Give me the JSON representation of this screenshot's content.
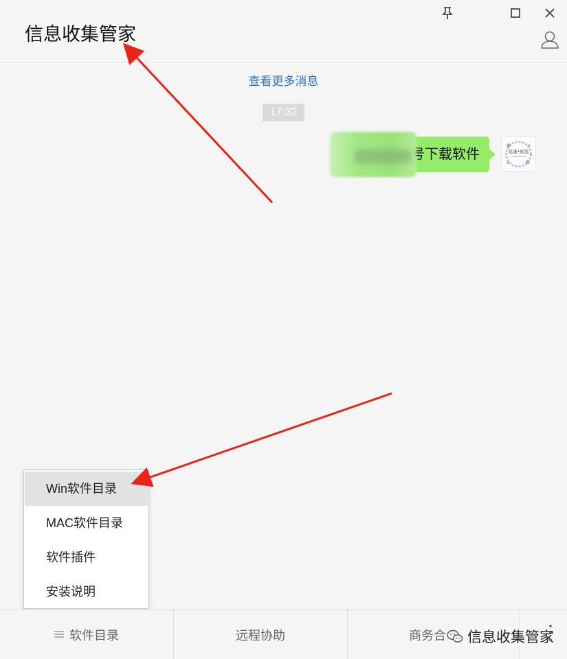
{
  "window": {
    "chat_title": "信息收集管家",
    "controls": [
      "pin-icon",
      "maximize-icon",
      "close-icon"
    ],
    "profile_icon": "person-icon"
  },
  "messages": {
    "load_more": "查看更多消息",
    "timestamp": "17:32",
    "sent_message": {
      "visible_text": "号下载软件",
      "bubble_color": "#95ec69",
      "avatar_text": "花漾•知见"
    }
  },
  "popup_menu": {
    "items": [
      {
        "label": "Win软件目录",
        "highlighted": true
      },
      {
        "label": "MAC软件目录",
        "highlighted": false
      },
      {
        "label": "软件插件",
        "highlighted": false
      },
      {
        "label": "安装说明",
        "highlighted": false
      }
    ]
  },
  "bottom_menu": {
    "tabs": [
      {
        "label": "软件目录",
        "icon": "menu-lines-icon"
      },
      {
        "label": "远程协助"
      },
      {
        "label": "商务合"
      }
    ]
  },
  "watermark": {
    "text": "信息收集管家",
    "icon": "wechat-icon"
  },
  "colors": {
    "link": "#2b73c9",
    "annotation_arrow": "#e8231a",
    "menu_highlight": "#e2e2e2"
  }
}
